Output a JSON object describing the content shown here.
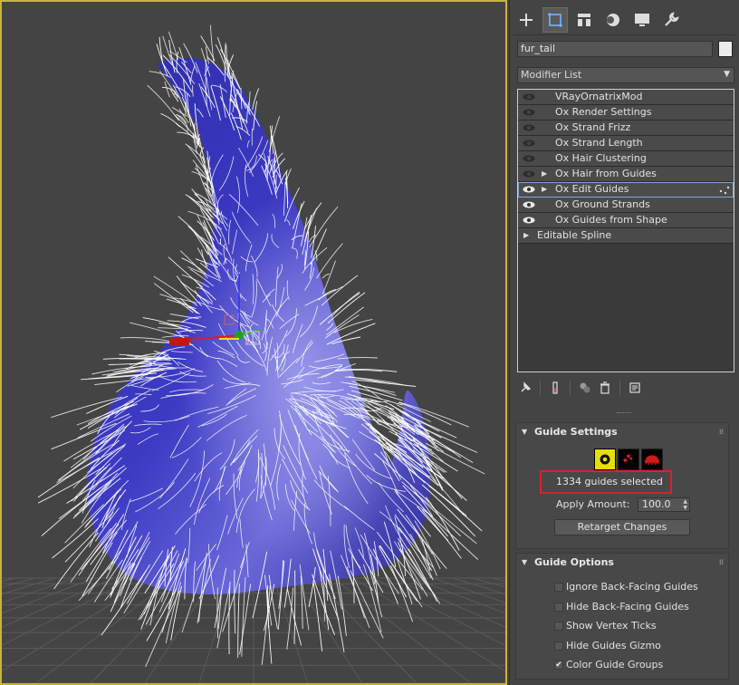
{
  "viewport": {
    "border_color": "#c8b43c",
    "mesh_color": "#3a37b4",
    "hair_color": "#ffffff"
  },
  "command_panel": {
    "tabs": [
      {
        "name": "create-tab",
        "icon": "plus-icon"
      },
      {
        "name": "modify-tab",
        "icon": "modify-icon",
        "active": true
      },
      {
        "name": "hierarchy-tab",
        "icon": "hierarchy-icon"
      },
      {
        "name": "motion-tab",
        "icon": "motion-icon"
      },
      {
        "name": "display-tab",
        "icon": "display-icon"
      },
      {
        "name": "utilities-tab",
        "icon": "wrench-icon"
      }
    ],
    "object_name": "fur_tail",
    "object_color": "#ececec",
    "modifier_list_label": "Modifier List",
    "stack": [
      {
        "label": "VRayOrnatrixMod",
        "eye": "dim",
        "expand": false
      },
      {
        "label": "Ox Render Settings",
        "eye": "dim",
        "expand": false
      },
      {
        "label": "Ox Strand Frizz",
        "eye": "dim",
        "expand": false
      },
      {
        "label": "Ox Strand Length",
        "eye": "dim",
        "expand": false
      },
      {
        "label": "Ox Hair Clustering",
        "eye": "dim",
        "expand": false
      },
      {
        "label": "Ox Hair from Guides",
        "eye": "dim",
        "expand": true
      },
      {
        "label": "Ox Edit Guides",
        "eye": "on",
        "expand": true,
        "selected": true
      },
      {
        "label": "Ox Ground Strands",
        "eye": "on",
        "expand": false
      },
      {
        "label": "Ox Guides from Shape",
        "eye": "on",
        "expand": false
      },
      {
        "label": "Editable Spline",
        "eye": "none",
        "expand": true,
        "base": true
      }
    ]
  },
  "guide_settings": {
    "title": "Guide Settings",
    "selection_status": "1334 guides selected",
    "apply_amount_label": "Apply Amount:",
    "apply_amount_value": "100.0",
    "retarget_label": "Retarget Changes"
  },
  "guide_options": {
    "title": "Guide Options",
    "items": [
      {
        "label": "Ignore Back-Facing Guides",
        "checked": false
      },
      {
        "label": "Hide Back-Facing Guides",
        "checked": false
      },
      {
        "label": "Show Vertex Ticks",
        "checked": false
      },
      {
        "label": "Hide Guides Gizmo",
        "checked": false
      },
      {
        "label": "Color Guide Groups",
        "checked": true
      }
    ]
  }
}
